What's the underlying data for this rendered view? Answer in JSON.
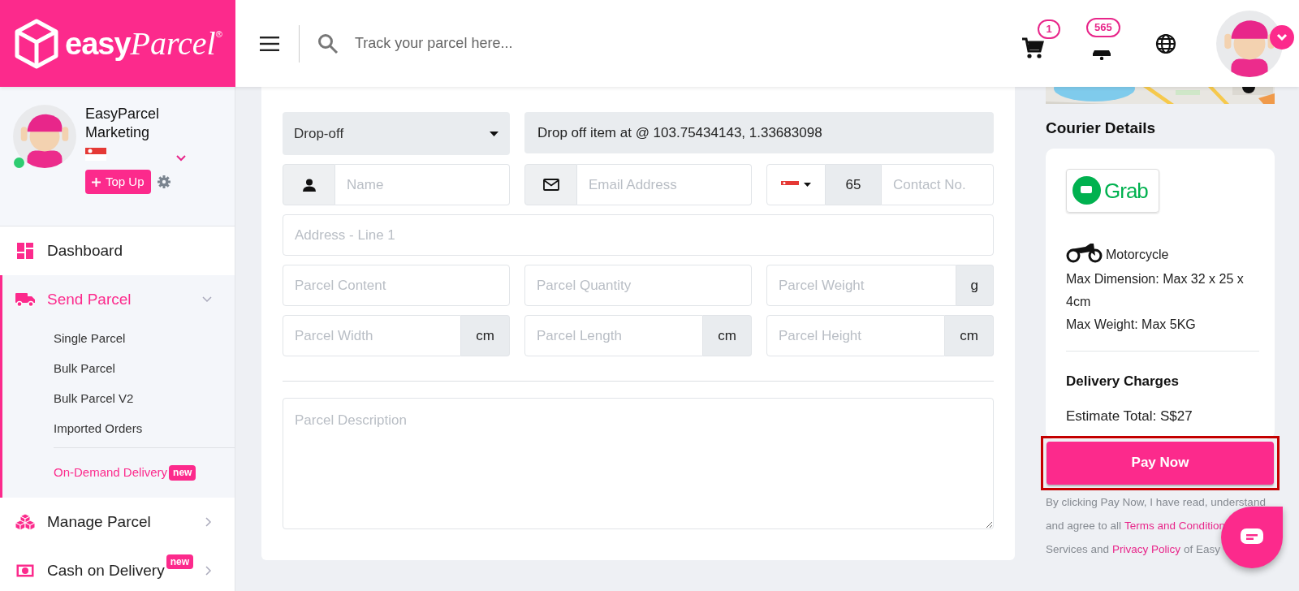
{
  "header": {
    "logo": {
      "first": "easy",
      "second": "Parcel",
      "mark": "®"
    },
    "search": {
      "placeholder": "Track your parcel here..."
    },
    "cart_count": "1",
    "notification_count": "565"
  },
  "profile": {
    "name": "EasyParcel Marketing",
    "online": true,
    "top_up": "Top Up"
  },
  "sidebar": {
    "items": [
      {
        "label": "Dashboard",
        "kind": "link",
        "selected": false
      },
      {
        "label": "Send Parcel",
        "kind": "group",
        "selected": true,
        "expanded": true,
        "children": [
          {
            "label": "Single Parcel",
            "selected": false,
            "divider_before": false
          },
          {
            "label": "Bulk Parcel",
            "selected": false,
            "divider_before": false
          },
          {
            "label": "Bulk Parcel V2",
            "selected": false,
            "divider_before": false
          },
          {
            "label": "Imported Orders",
            "selected": false,
            "divider_before": false
          },
          {
            "label": "On-Demand Delivery",
            "selected": true,
            "divider_before": true,
            "badge": "new"
          }
        ]
      },
      {
        "label": "Manage Parcel",
        "kind": "group",
        "selected": false,
        "expanded": false
      },
      {
        "label": "Cash on Delivery",
        "kind": "group",
        "selected": false,
        "expanded": false,
        "badge": "new"
      }
    ]
  },
  "form": {
    "delivery_type": {
      "value": "Drop-off"
    },
    "location": {
      "value": "Drop off item at @ 103.75434143, 1.33683098"
    },
    "name": {
      "placeholder": "Name"
    },
    "email": {
      "placeholder": "Email Address"
    },
    "phone": {
      "country_code": "65",
      "placeholder": "Contact No."
    },
    "address": {
      "placeholder": "Address - Line 1"
    },
    "parcel_fields": [
      {
        "placeholder": "Parcel Content"
      },
      {
        "placeholder": "Parcel Quantity"
      },
      {
        "placeholder": "Parcel Weight",
        "unit": "g"
      },
      {
        "placeholder": "Parcel Width",
        "unit": "cm"
      },
      {
        "placeholder": "Parcel Length",
        "unit": "cm"
      },
      {
        "placeholder": "Parcel Height",
        "unit": "cm"
      }
    ],
    "description": {
      "placeholder": "Parcel Description"
    }
  },
  "courier": {
    "title": "Courier Details",
    "logo_text": "Grab",
    "vehicle": "Motorcycle",
    "max_dimension": "Max Dimension: Max 32 x 25 x 4cm",
    "max_weight": "Max Weight: Max 5KG",
    "charges_title": "Delivery Charges",
    "estimate": "Estimate Total: S$27",
    "pay_button": "Pay Now",
    "terms_lines": [
      [
        {
          "kind": "text",
          "text": "By clicking Pay Now, I have read, understand"
        }
      ],
      [
        {
          "kind": "text",
          "text": "and agree to all"
        },
        {
          "kind": "link",
          "text": "Terms and Condition"
        }
      ],
      [
        {
          "kind": "text",
          "text": "Services and"
        },
        {
          "kind": "link",
          "text": "Privacy Policy"
        },
        {
          "kind": "text",
          "text": "of Easy"
        }
      ]
    ]
  }
}
